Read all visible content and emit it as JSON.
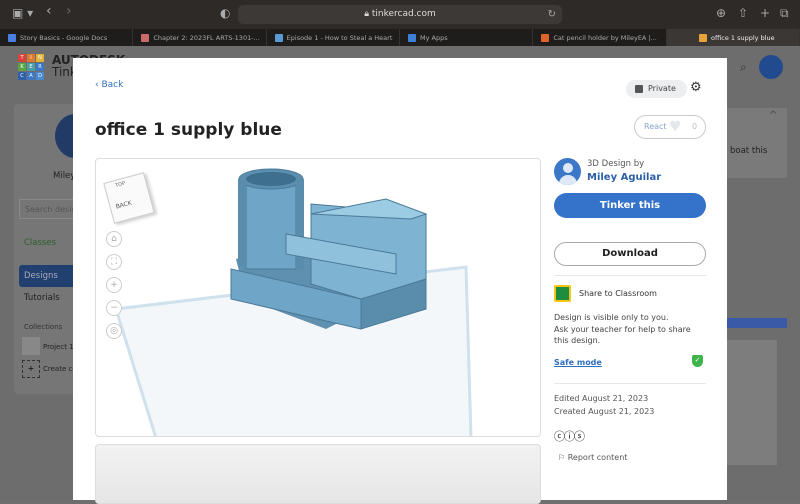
{
  "browser": {
    "url": "tinkercad.com",
    "tabs": [
      {
        "label": "Story Basics - Google Docs",
        "color": "#4a7fe0"
      },
      {
        "label": "Chapter 2: 2023FL ARTS-1301-...",
        "color": "#c96b6b"
      },
      {
        "label": "Episode 1 - How to Steal a Heart",
        "color": "#5b9bd5"
      },
      {
        "label": "My Apps",
        "color": "#3f7fd6"
      },
      {
        "label": "Cat pencil holder by MileyEA |...",
        "color": "#e0622c"
      },
      {
        "label": "office 1 supply blue",
        "color": "#e8a33a",
        "active": true
      }
    ]
  },
  "background": {
    "logo_letters": [
      "T",
      "I",
      "N",
      "K",
      "E",
      "R",
      "C",
      "A",
      "D"
    ],
    "brand": "AUTODESK",
    "brand_sub": "Tinkercad",
    "user_short": "Miley",
    "search_placeholder": "Search designs",
    "nav": [
      "Classes",
      "Designs",
      "Tutorials"
    ],
    "collections_label": "Collections",
    "collection_item": "Project 1",
    "create_collection": "Create collection",
    "right_text": "boat this"
  },
  "modal": {
    "back_label": "Back",
    "privacy": "Private",
    "react_label": "React",
    "react_count": "0",
    "title": "office 1 supply blue",
    "viewcube_top": "TOP",
    "viewcube_front": "BACK",
    "author_prefix": "3D Design by",
    "author": "Miley Aguilar",
    "tinker_button": "Tinker this",
    "download_button": "Download",
    "share_classroom": "Share to Classroom",
    "visibility_line1": "Design is visible only to you.",
    "visibility_line2": "Ask your teacher for help to share this design.",
    "safe_mode": "Safe mode",
    "edited": "Edited August 21, 2023",
    "created": "Created August 21, 2023",
    "license_icons": "🅭🅯🄎",
    "report": "Report content",
    "model_color": "#6fa6c8"
  }
}
